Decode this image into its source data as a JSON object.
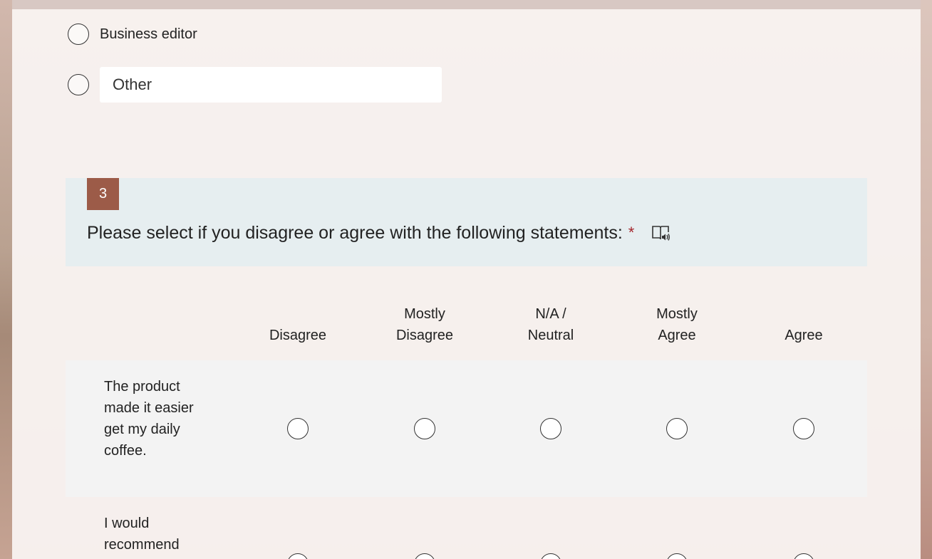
{
  "options": {
    "business_editor": "Business editor",
    "other_placeholder": "Other"
  },
  "question": {
    "number": "3",
    "title": "Please select if you disagree or agree with the following statements:",
    "required_marker": "*"
  },
  "likert": {
    "columns": [
      {
        "line1": "",
        "line2": "Disagree"
      },
      {
        "line1": "Mostly",
        "line2": "Disagree"
      },
      {
        "line1": "N/A /",
        "line2": "Neutral"
      },
      {
        "line1": "Mostly",
        "line2": "Agree"
      },
      {
        "line1": "",
        "line2": "Agree"
      }
    ],
    "rows": [
      {
        "statement": "The product made it easier get my daily coffee."
      },
      {
        "statement": "I would recommend"
      }
    ]
  },
  "colors": {
    "question_number_bg": "#9c5b48",
    "required": "#a4262c",
    "header_bg": "#e6eef0"
  }
}
